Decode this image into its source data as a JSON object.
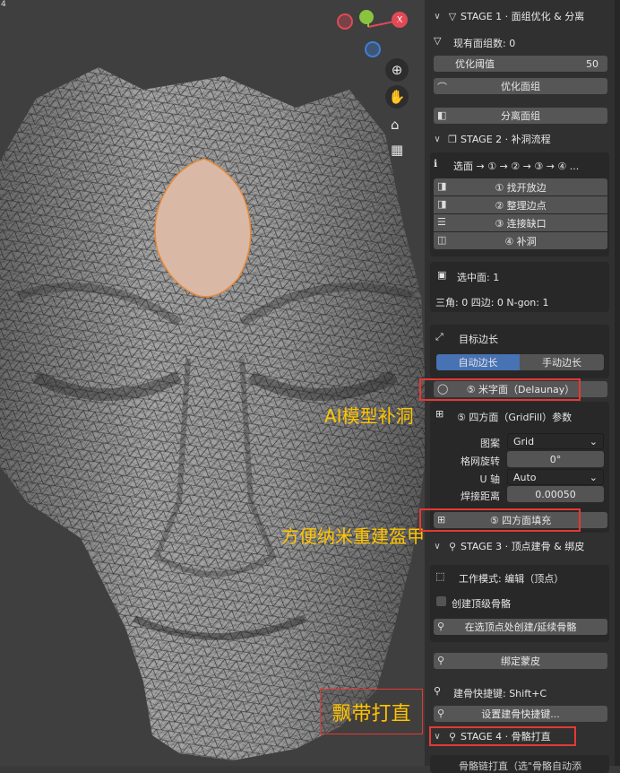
{
  "viewport": {
    "corner_digit": "4",
    "gizmo": {
      "x_label": "X",
      "colors": {
        "x": "#e04a56",
        "y": "#8ac33d",
        "z": "#3f7fd9"
      }
    },
    "nav_icons": [
      "zoom-icon",
      "hand-pan-icon",
      "camera-icon",
      "grid-icon"
    ],
    "mesh_color": "#8f8f8f",
    "wire_color": "#1a1a1a",
    "selected_face_color": "#d9b9a6",
    "selected_edge_color": "#e88a3a"
  },
  "stage1": {
    "title": "STAGE 1 · 面组优化 & 分离",
    "face_count_label": "现有面组数: 0",
    "threshold_label": "优化阈值",
    "threshold_value": "50",
    "optimize_button": "优化面组",
    "separate_button": "分离面组"
  },
  "stage2": {
    "title": "STAGE 2 · 补洞流程",
    "flow_text": "选面 → ① → ② → ③ → ④ ...",
    "steps": [
      "① 找开放边",
      "② 整理边点",
      "③ 连接缺口",
      "④ 补洞"
    ],
    "selected_faces": "选中面: 1",
    "stats": "三角: 0  四边: 0  N-gon: 1",
    "target_edge_label": "目标边长",
    "auto_edge": "自动边长",
    "manual_edge": "手动边长",
    "delaunay_button": "⑤ 米字面（Delaunay）",
    "gridfill_title": "⑤ 四方面（GridFill）参数",
    "pattern_label": "图案",
    "pattern_value": "Grid",
    "rotation_label": "格网旋转",
    "rotation_value": "0°",
    "u_axis_label": "U 轴",
    "u_axis_value": "Auto",
    "weld_label": "焊接距离",
    "weld_value": "0.00050",
    "quad_fill_button": "⑤ 四方面填充"
  },
  "stage3": {
    "title": "STAGE 3 · 顶点建骨 & 绑皮",
    "mode_label": "工作模式: 编辑（顶点）",
    "top_bone_checkbox": "创建顶级骨骼",
    "create_bone_button": "在选顶点处创建/延续骨骼",
    "bind_skin_button": "绑定蒙皮",
    "shortcut_label": "建骨快捷键: Shift+C",
    "set_shortcut_button": "设置建骨快捷键..."
  },
  "stage4": {
    "title": "STAGE 4 · 骨骼打直",
    "cut_text": "骨骼链打直（选\"骨骼自动添"
  },
  "annotations": {
    "ai_fill": "AI模型补洞",
    "nano_rebuild": "方便纳米重建盔甲",
    "ribbon": "飘带打直"
  },
  "accent_color": "#4772b3",
  "annotation_color": "#ffc400",
  "highlight_color": "#e53935"
}
